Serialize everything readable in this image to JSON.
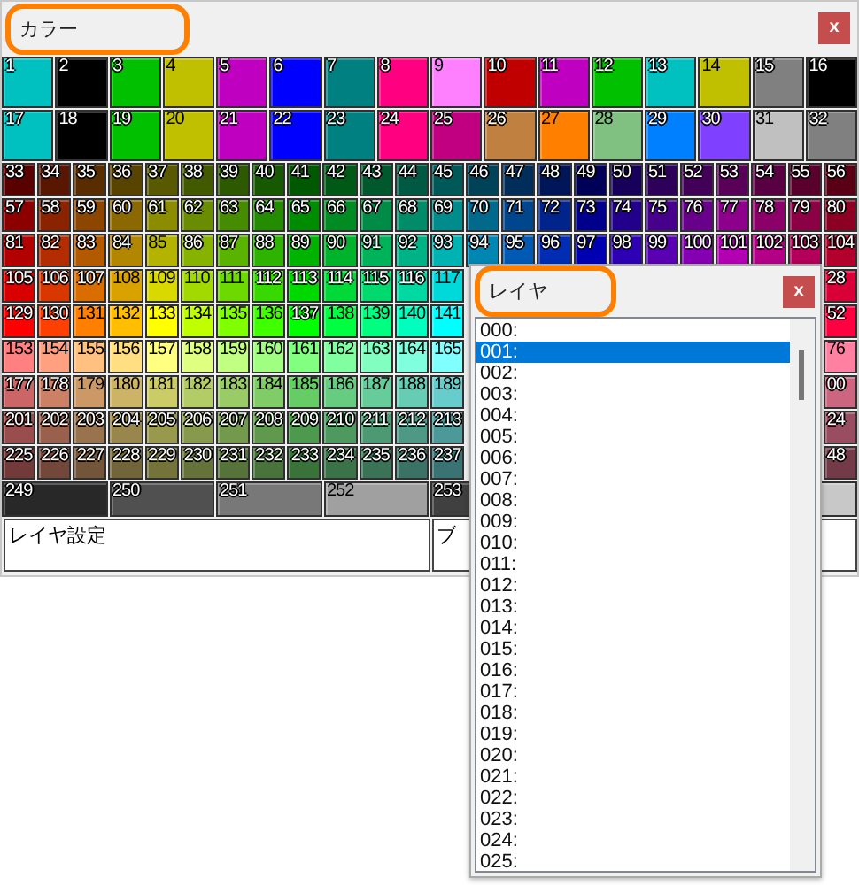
{
  "color_window": {
    "title": "カラー",
    "close": "x",
    "top_swatches": [
      [
        {
          "label": "1",
          "color": "#00c0c0"
        },
        {
          "label": "2",
          "color": "#000000"
        },
        {
          "label": "3",
          "color": "#00c000"
        },
        {
          "label": "4",
          "color": "#c0c000"
        },
        {
          "label": "5",
          "color": "#c000c0"
        },
        {
          "label": "6",
          "color": "#0000ff"
        },
        {
          "label": "7",
          "color": "#008080"
        },
        {
          "label": "8",
          "color": "#ff0080"
        },
        {
          "label": "9",
          "color": "#ff80ff"
        },
        {
          "label": "10",
          "color": "#c00000"
        },
        {
          "label": "11",
          "color": "#c000c0"
        },
        {
          "label": "12",
          "color": "#00c000"
        },
        {
          "label": "13",
          "color": "#00c0c0"
        },
        {
          "label": "14",
          "color": "#c0c000"
        },
        {
          "label": "15",
          "color": "#808080"
        },
        {
          "label": "16",
          "color": "#000000"
        }
      ],
      [
        {
          "label": "17",
          "color": "#00c0c0"
        },
        {
          "label": "18",
          "color": "#000000"
        },
        {
          "label": "19",
          "color": "#00c000"
        },
        {
          "label": "20",
          "color": "#c0c000"
        },
        {
          "label": "21",
          "color": "#c000c0"
        },
        {
          "label": "22",
          "color": "#0000ff"
        },
        {
          "label": "23",
          "color": "#008080"
        },
        {
          "label": "24",
          "color": "#ff0080"
        },
        {
          "label": "25",
          "color": "#c00080"
        },
        {
          "label": "26",
          "color": "#c08040"
        },
        {
          "label": "27",
          "color": "#ff8000"
        },
        {
          "label": "28",
          "color": "#80c080"
        },
        {
          "label": "29",
          "color": "#0080ff"
        },
        {
          "label": "30",
          "color": "#8040ff"
        },
        {
          "label": "31",
          "color": "#c0c0c0"
        },
        {
          "label": "32",
          "color": "#808080"
        }
      ]
    ],
    "shade_swatches": [
      {
        "left": [
          {
            "label": "33",
            "color": "#590000"
          },
          {
            "label": "34",
            "color": "#591600"
          },
          {
            "label": "35",
            "color": "#592d00"
          },
          {
            "label": "36",
            "color": "#594300"
          },
          {
            "label": "37",
            "color": "#595900"
          },
          {
            "label": "38",
            "color": "#435900"
          },
          {
            "label": "39",
            "color": "#2d5900"
          },
          {
            "label": "40",
            "color": "#165900"
          },
          {
            "label": "41",
            "color": "#005900"
          },
          {
            "label": "42",
            "color": "#005916"
          },
          {
            "label": "43",
            "color": "#00592d"
          },
          {
            "label": "44",
            "color": "#005943"
          },
          {
            "label": "45",
            "color": "#005959"
          },
          {
            "label": "46",
            "color": "#004359"
          },
          {
            "label": "47",
            "color": "#002d59"
          },
          {
            "label": "48",
            "color": "#001659"
          },
          {
            "label": "49",
            "color": "#000059"
          },
          {
            "label": "50",
            "color": "#160059"
          },
          {
            "label": "51",
            "color": "#2d0059"
          },
          {
            "label": "52",
            "color": "#430059"
          },
          {
            "label": "53",
            "color": "#590059"
          },
          {
            "label": "54",
            "color": "#590043"
          },
          {
            "label": "55",
            "color": "#59002d"
          },
          {
            "label": "56",
            "color": "#590016"
          }
        ]
      },
      {
        "left": [
          {
            "label": "57",
            "color": "#8c0000"
          },
          {
            "label": "58",
            "color": "#8c2300"
          },
          {
            "label": "59",
            "color": "#8c4600"
          },
          {
            "label": "60",
            "color": "#8c6900"
          },
          {
            "label": "61",
            "color": "#8c8c00"
          },
          {
            "label": "62",
            "color": "#698c00"
          },
          {
            "label": "63",
            "color": "#468c00"
          },
          {
            "label": "64",
            "color": "#238c00"
          },
          {
            "label": "65",
            "color": "#008c00"
          },
          {
            "label": "66",
            "color": "#008c23"
          },
          {
            "label": "67",
            "color": "#008c46"
          },
          {
            "label": "68",
            "color": "#008c69"
          },
          {
            "label": "69",
            "color": "#008c8c"
          },
          {
            "label": "70",
            "color": "#00698c"
          },
          {
            "label": "71",
            "color": "#00468c"
          },
          {
            "label": "72",
            "color": "#00238c"
          },
          {
            "label": "73",
            "color": "#00008c"
          },
          {
            "label": "74",
            "color": "#23008c"
          },
          {
            "label": "75",
            "color": "#46008c"
          },
          {
            "label": "76",
            "color": "#69008c"
          },
          {
            "label": "77",
            "color": "#8c008c"
          },
          {
            "label": "78",
            "color": "#8c0069"
          },
          {
            "label": "79",
            "color": "#8c0046"
          },
          {
            "label": "80",
            "color": "#8c0023"
          }
        ]
      },
      {
        "left": [
          {
            "label": "81",
            "color": "#b30000"
          },
          {
            "label": "82",
            "color": "#b32d00"
          },
          {
            "label": "83",
            "color": "#b35a00"
          },
          {
            "label": "84",
            "color": "#b38600"
          },
          {
            "label": "85",
            "color": "#b3b300"
          },
          {
            "label": "86",
            "color": "#86b300"
          },
          {
            "label": "87",
            "color": "#5ab300"
          },
          {
            "label": "88",
            "color": "#2db300"
          },
          {
            "label": "89",
            "color": "#00b300"
          },
          {
            "label": "90",
            "color": "#00b32d"
          },
          {
            "label": "91",
            "color": "#00b35a"
          },
          {
            "label": "92",
            "color": "#00b386"
          },
          {
            "label": "93",
            "color": "#00b3b3"
          },
          {
            "label": "94",
            "color": "#0086b3"
          },
          {
            "label": "95",
            "color": "#005ab3"
          },
          {
            "label": "96",
            "color": "#002db3"
          },
          {
            "label": "97",
            "color": "#0000b3"
          },
          {
            "label": "98",
            "color": "#2d00b3"
          },
          {
            "label": "99",
            "color": "#5a00b3"
          },
          {
            "label": "100",
            "color": "#8600b3"
          },
          {
            "label": "101",
            "color": "#b300b3"
          },
          {
            "label": "102",
            "color": "#b30086"
          },
          {
            "label": "103",
            "color": "#b3005a"
          },
          {
            "label": "104",
            "color": "#b3002d"
          }
        ]
      },
      {
        "left": [
          {
            "label": "105",
            "color": "#d90000"
          },
          {
            "label": "106",
            "color": "#d93700"
          },
          {
            "label": "107",
            "color": "#d96d00"
          },
          {
            "label": "108",
            "color": "#d9a200"
          },
          {
            "label": "109",
            "color": "#d9d900"
          },
          {
            "label": "110",
            "color": "#a2d900"
          },
          {
            "label": "111",
            "color": "#6dd900"
          },
          {
            "label": "112",
            "color": "#37d900"
          },
          {
            "label": "113",
            "color": "#00d900"
          },
          {
            "label": "114",
            "color": "#00d937"
          },
          {
            "label": "115",
            "color": "#00d96d"
          },
          {
            "label": "116",
            "color": "#00d9a2"
          },
          {
            "label": "117",
            "color": "#00d9d9"
          }
        ],
        "right": [
          {
            "label": "28",
            "color": "#d90037"
          }
        ]
      },
      {
        "left": [
          {
            "label": "129",
            "color": "#ff0000"
          },
          {
            "label": "130",
            "color": "#ff4000"
          },
          {
            "label": "131",
            "color": "#ff8000"
          },
          {
            "label": "132",
            "color": "#ffbf00"
          },
          {
            "label": "133",
            "color": "#ffff00"
          },
          {
            "label": "134",
            "color": "#bfff00"
          },
          {
            "label": "135",
            "color": "#80ff00"
          },
          {
            "label": "136",
            "color": "#40ff00"
          },
          {
            "label": "137",
            "color": "#00ff00"
          },
          {
            "label": "138",
            "color": "#00ff40"
          },
          {
            "label": "139",
            "color": "#00ff80"
          },
          {
            "label": "140",
            "color": "#00ffbf"
          },
          {
            "label": "141",
            "color": "#00ffff"
          }
        ],
        "right": [
          {
            "label": "52",
            "color": "#ff0040"
          }
        ]
      },
      {
        "left": [
          {
            "label": "153",
            "color": "#ff8080"
          },
          {
            "label": "154",
            "color": "#ffa080"
          },
          {
            "label": "155",
            "color": "#ffc080"
          },
          {
            "label": "156",
            "color": "#ffdf80"
          },
          {
            "label": "157",
            "color": "#ffff80"
          },
          {
            "label": "158",
            "color": "#dfff80"
          },
          {
            "label": "159",
            "color": "#c0ff80"
          },
          {
            "label": "160",
            "color": "#a0ff80"
          },
          {
            "label": "161",
            "color": "#80ff80"
          },
          {
            "label": "162",
            "color": "#80ffa0"
          },
          {
            "label": "163",
            "color": "#80ffc0"
          },
          {
            "label": "164",
            "color": "#80ffdf"
          },
          {
            "label": "165",
            "color": "#80ffff"
          }
        ],
        "right": [
          {
            "label": "76",
            "color": "#ff80a0"
          }
        ]
      },
      {
        "left": [
          {
            "label": "177",
            "color": "#cc6666"
          },
          {
            "label": "178",
            "color": "#cc8066"
          },
          {
            "label": "179",
            "color": "#cc9966"
          },
          {
            "label": "180",
            "color": "#ccb366"
          },
          {
            "label": "181",
            "color": "#cccc66"
          },
          {
            "label": "182",
            "color": "#b3cc66"
          },
          {
            "label": "183",
            "color": "#99cc66"
          },
          {
            "label": "184",
            "color": "#80cc66"
          },
          {
            "label": "185",
            "color": "#66cc66"
          },
          {
            "label": "186",
            "color": "#66cc80"
          },
          {
            "label": "187",
            "color": "#66cc99"
          },
          {
            "label": "188",
            "color": "#66ccb3"
          },
          {
            "label": "189",
            "color": "#66cccc"
          }
        ],
        "right": [
          {
            "label": "00",
            "color": "#cc6680"
          }
        ]
      },
      {
        "left": [
          {
            "label": "201",
            "color": "#994d4d"
          },
          {
            "label": "202",
            "color": "#99604d"
          },
          {
            "label": "203",
            "color": "#99734d"
          },
          {
            "label": "204",
            "color": "#99864d"
          },
          {
            "label": "205",
            "color": "#99994d"
          },
          {
            "label": "206",
            "color": "#86994d"
          },
          {
            "label": "207",
            "color": "#73994d"
          },
          {
            "label": "208",
            "color": "#60994d"
          },
          {
            "label": "209",
            "color": "#4d994d"
          },
          {
            "label": "210",
            "color": "#4d9960"
          },
          {
            "label": "211",
            "color": "#4d9973"
          },
          {
            "label": "212",
            "color": "#4d9986"
          },
          {
            "label": "213",
            "color": "#4d9999"
          }
        ],
        "right": [
          {
            "label": "24",
            "color": "#994d60"
          }
        ]
      },
      {
        "left": [
          {
            "label": "225",
            "color": "#733a3a"
          },
          {
            "label": "226",
            "color": "#73483a"
          },
          {
            "label": "227",
            "color": "#73563a"
          },
          {
            "label": "228",
            "color": "#73653a"
          },
          {
            "label": "229",
            "color": "#73733a"
          },
          {
            "label": "230",
            "color": "#65733a"
          },
          {
            "label": "231",
            "color": "#56733a"
          },
          {
            "label": "232",
            "color": "#48733a"
          },
          {
            "label": "233",
            "color": "#3a733a"
          },
          {
            "label": "234",
            "color": "#3a7348"
          },
          {
            "label": "235",
            "color": "#3a7356"
          },
          {
            "label": "236",
            "color": "#3a7365"
          },
          {
            "label": "237",
            "color": "#3a7373"
          }
        ],
        "right": [
          {
            "label": "48",
            "color": "#733a48"
          }
        ]
      }
    ],
    "gray_swatches": {
      "left": [
        {
          "label": "249",
          "color": "#282828"
        },
        {
          "label": "250",
          "color": "#505050"
        },
        {
          "label": "251",
          "color": "#787878"
        },
        {
          "label": "252",
          "color": "#a0a0a0"
        },
        {
          "label": "253",
          "color": "#404040"
        }
      ],
      "right": [
        {
          "color": "#c8c8c8"
        }
      ]
    },
    "text_fields": [
      "レイヤ設定",
      "ブ"
    ]
  },
  "layer_window": {
    "title": "レイヤ",
    "close": "x",
    "layers": [
      {
        "label": "000:",
        "selected": false
      },
      {
        "label": "001:",
        "selected": true
      },
      {
        "label": "002:",
        "selected": false
      },
      {
        "label": "003:",
        "selected": false
      },
      {
        "label": "004:",
        "selected": false
      },
      {
        "label": "005:",
        "selected": false
      },
      {
        "label": "006:",
        "selected": false
      },
      {
        "label": "007:",
        "selected": false
      },
      {
        "label": "008:",
        "selected": false
      },
      {
        "label": "009:",
        "selected": false
      },
      {
        "label": "010:",
        "selected": false
      },
      {
        "label": "011:",
        "selected": false
      },
      {
        "label": "012:",
        "selected": false
      },
      {
        "label": "013:",
        "selected": false
      },
      {
        "label": "014:",
        "selected": false
      },
      {
        "label": "015:",
        "selected": false
      },
      {
        "label": "016:",
        "selected": false
      },
      {
        "label": "017:",
        "selected": false
      },
      {
        "label": "018:",
        "selected": false
      },
      {
        "label": "019:",
        "selected": false
      },
      {
        "label": "020:",
        "selected": false
      },
      {
        "label": "021:",
        "selected": false
      },
      {
        "label": "022:",
        "selected": false
      },
      {
        "label": "023:",
        "selected": false
      },
      {
        "label": "024:",
        "selected": false
      },
      {
        "label": "025:",
        "selected": false
      }
    ]
  }
}
